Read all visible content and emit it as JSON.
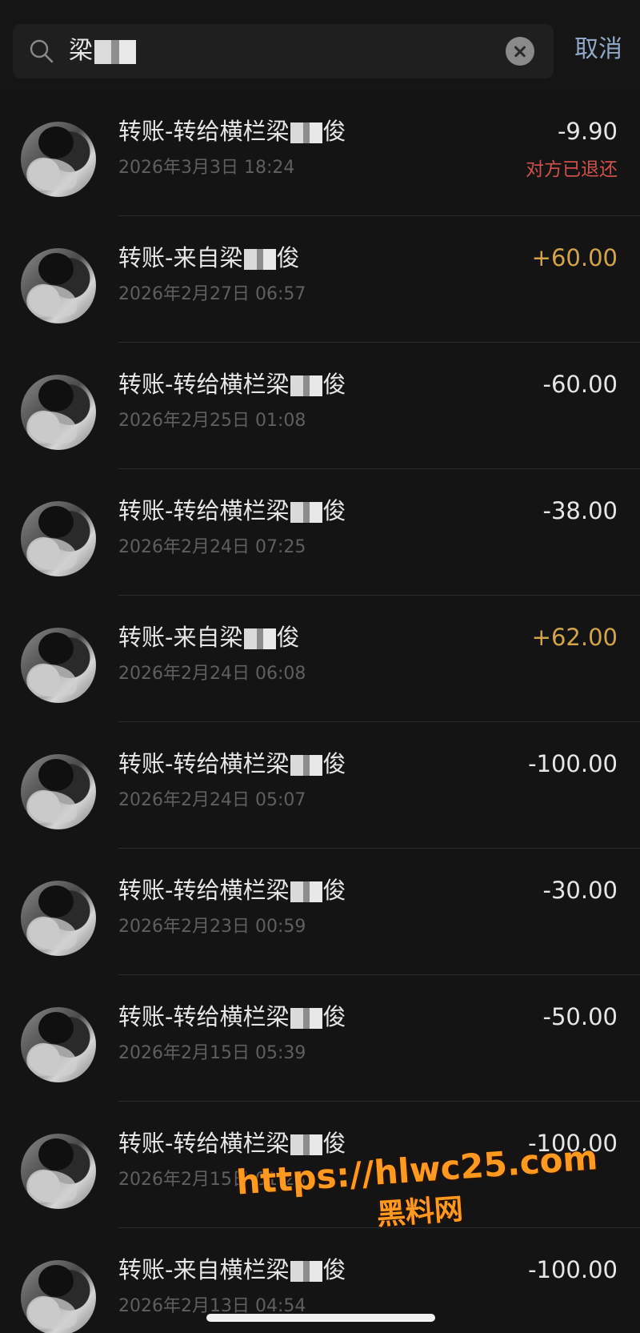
{
  "search": {
    "query": "梁",
    "cancel_label": "取消"
  },
  "transactions": [
    {
      "title": "转账-转给横栏梁",
      "title_suffix": "俊",
      "time": "2026年3月3日 18:24",
      "amount": "-9.90",
      "direction": "out",
      "status": "对方已退还"
    },
    {
      "title": "转账-来自梁",
      "title_suffix": "俊",
      "time": "2026年2月27日 06:57",
      "amount": "+60.00",
      "direction": "in",
      "status": ""
    },
    {
      "title": "转账-转给横栏梁",
      "title_suffix": "俊",
      "time": "2026年2月25日 01:08",
      "amount": "-60.00",
      "direction": "out",
      "status": ""
    },
    {
      "title": "转账-转给横栏梁",
      "title_suffix": "俊",
      "time": "2026年2月24日 07:25",
      "amount": "-38.00",
      "direction": "out",
      "status": ""
    },
    {
      "title": "转账-来自梁",
      "title_suffix": "俊",
      "time": "2026年2月24日 06:08",
      "amount": "+62.00",
      "direction": "in",
      "status": ""
    },
    {
      "title": "转账-转给横栏梁",
      "title_suffix": "俊",
      "time": "2026年2月24日 05:07",
      "amount": "-100.00",
      "direction": "out",
      "status": ""
    },
    {
      "title": "转账-转给横栏梁",
      "title_suffix": "俊",
      "time": "2026年2月23日 00:59",
      "amount": "-30.00",
      "direction": "out",
      "status": ""
    },
    {
      "title": "转账-转给横栏梁",
      "title_suffix": "俊",
      "time": "2026年2月15日 05:39",
      "amount": "-50.00",
      "direction": "out",
      "status": ""
    },
    {
      "title": "转账-转给横栏梁",
      "title_suffix": "俊",
      "time": "2026年2月15日 01:23",
      "amount": "-100.00",
      "direction": "out",
      "status": ""
    },
    {
      "title": "转账-来自横栏梁",
      "title_suffix": "俊",
      "time": "2026年2月13日 04:54",
      "amount": "-100.00",
      "direction": "out",
      "status": ""
    }
  ],
  "watermark": {
    "url": "https://hlwc25.com",
    "name": "黑料网"
  },
  "colors": {
    "background": "#141414",
    "amount_in": "#d4a44a",
    "amount_out": "#e6e6e6",
    "status_refunded": "#d0504b",
    "cancel": "#8fa8c8",
    "watermark": "#ff9a1f"
  },
  "icons": {
    "search": "search-icon",
    "clear": "clear-icon",
    "avatar": "avatar"
  }
}
